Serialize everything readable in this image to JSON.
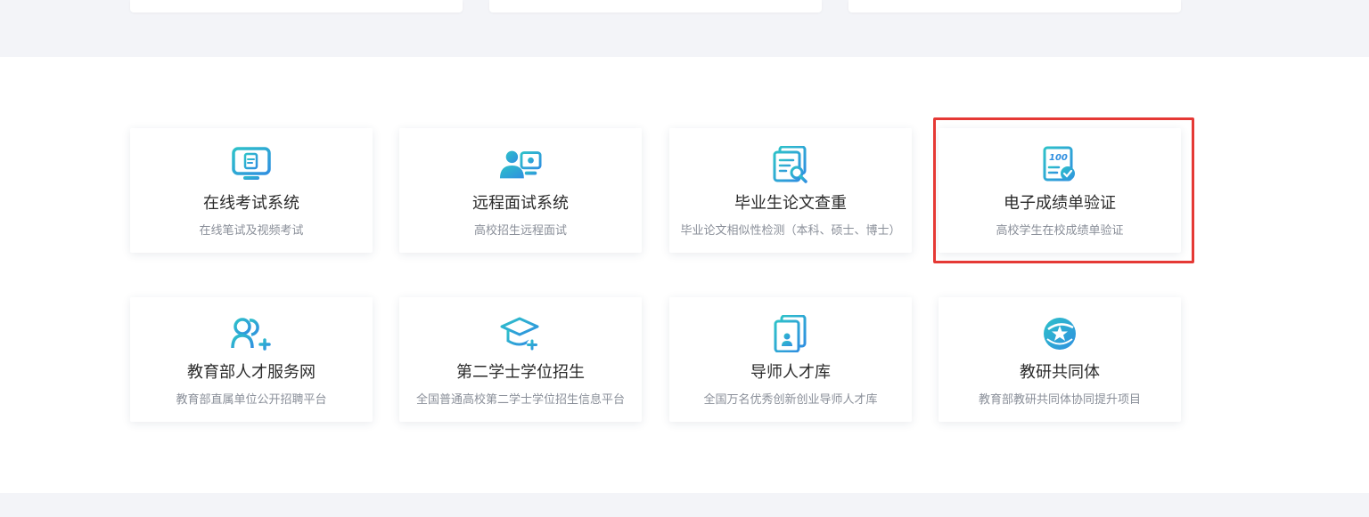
{
  "colors": {
    "accent_blue": "#2f8fe0",
    "accent_teal": "#2ec1c9",
    "highlight_red": "#e53935",
    "title_text": "#2b2b2b",
    "subtitle_text": "#8a8f99"
  },
  "services_row1": [
    {
      "title": "在线考试系统",
      "subtitle": "在线笔试及视频考试",
      "icon": "monitor-exam-icon"
    },
    {
      "title": "远程面试系统",
      "subtitle": "高校招生远程面试",
      "icon": "video-interview-icon"
    },
    {
      "title": "毕业生论文查重",
      "subtitle": "毕业论文相似性检测（本科、硕士、博士）",
      "icon": "document-search-icon"
    },
    {
      "title": "电子成绩单验证",
      "subtitle": "高校学生在校成绩单验证",
      "icon": "transcript-verify-icon"
    }
  ],
  "services_row2": [
    {
      "title": "教育部人才服务网",
      "subtitle": "教育部直属单位公开招聘平台",
      "icon": "user-add-icon"
    },
    {
      "title": "第二学士学位招生",
      "subtitle": "全国普通高校第二学士学位招生信息平台",
      "icon": "graduation-cap-icon"
    },
    {
      "title": "导师人才库",
      "subtitle": "全国万名优秀创新创业导师人才库",
      "icon": "mentor-card-icon"
    },
    {
      "title": "教研共同体",
      "subtitle": "教育部教研共同体协同提升项目",
      "icon": "star-globe-icon"
    }
  ]
}
